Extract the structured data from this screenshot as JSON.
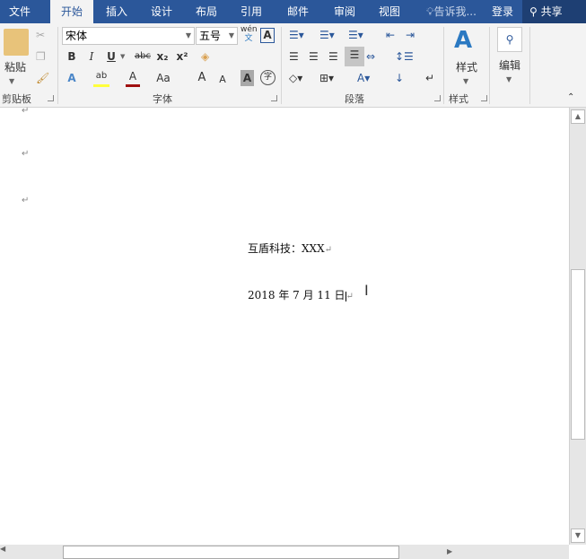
{
  "tabs": [
    {
      "label": "文件"
    },
    {
      "label": "开始"
    },
    {
      "label": "插入"
    },
    {
      "label": "设计"
    },
    {
      "label": "布局"
    },
    {
      "label": "引用"
    },
    {
      "label": "邮件"
    },
    {
      "label": "审阅"
    },
    {
      "label": "视图"
    }
  ],
  "tell_me": "告诉我...",
  "login": "登录",
  "share": "共享",
  "clipboard": {
    "paste": "粘贴",
    "group": "剪贴板"
  },
  "font": {
    "name": "宋体",
    "size": "五号",
    "wen": "wén",
    "wen_char": "文",
    "group": "字体",
    "bold": "B",
    "italic": "I",
    "underline": "U",
    "strike": "abc",
    "sub": "x₂",
    "sup": "x²",
    "grow": "A",
    "shrink": "A",
    "case": "Aa",
    "char_shade": "A",
    "enclose": "字",
    "effects": "A",
    "highlight": "ab",
    "color": "A",
    "border": "A"
  },
  "paragraph": {
    "group": "段落"
  },
  "styles": {
    "label": "样式",
    "group": "样式"
  },
  "editing": {
    "label": "编辑"
  },
  "document": {
    "line1": "互盾科技：XXX",
    "line2": "2018 年 7 月 11 日"
  }
}
